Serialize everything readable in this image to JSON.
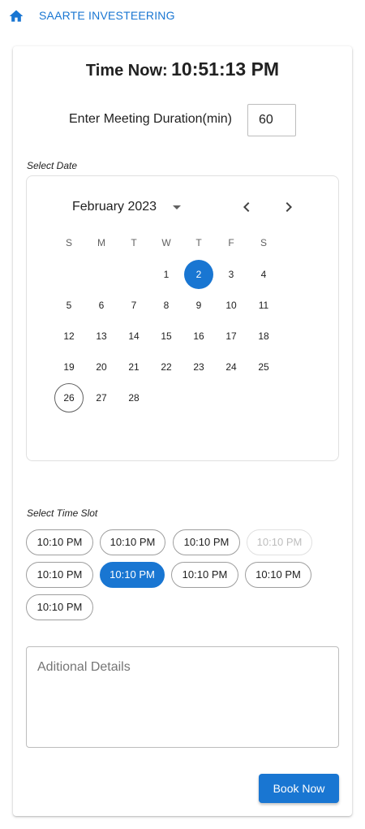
{
  "header": {
    "brand": "SAARTE INVESTEERING",
    "home_icon": "home-icon",
    "brand_color": "#1976d2"
  },
  "clock": {
    "label": "Time Now:",
    "value": "10:51:13 PM"
  },
  "duration": {
    "label": "Enter Meeting Duration(min)",
    "value": "60"
  },
  "calendar": {
    "section_label": "Select Date",
    "month_label": "February 2023",
    "prev_icon": "chevron-left-icon",
    "next_icon": "chevron-right-icon",
    "dropdown_icon": "caret-down-icon",
    "weekdays": [
      "S",
      "M",
      "T",
      "W",
      "T",
      "F",
      "S"
    ],
    "first_weekday_index": 3,
    "days_in_month": 28,
    "selected_day": 2,
    "today": 26
  },
  "slots": {
    "section_label": "Select Time Slot",
    "items": [
      {
        "label": "10:10 PM",
        "state": "normal"
      },
      {
        "label": "10:10 PM",
        "state": "normal"
      },
      {
        "label": "10:10 PM",
        "state": "normal"
      },
      {
        "label": "10:10 PM",
        "state": "disabled"
      },
      {
        "label": "10:10 PM",
        "state": "normal"
      },
      {
        "label": "10:10 PM",
        "state": "selected"
      },
      {
        "label": "10:10 PM",
        "state": "normal"
      },
      {
        "label": "10:10 PM",
        "state": "normal"
      },
      {
        "label": "10:10 PM",
        "state": "normal"
      }
    ]
  },
  "details": {
    "placeholder": "Aditional Details",
    "value": ""
  },
  "actions": {
    "book_label": "Book Now"
  }
}
